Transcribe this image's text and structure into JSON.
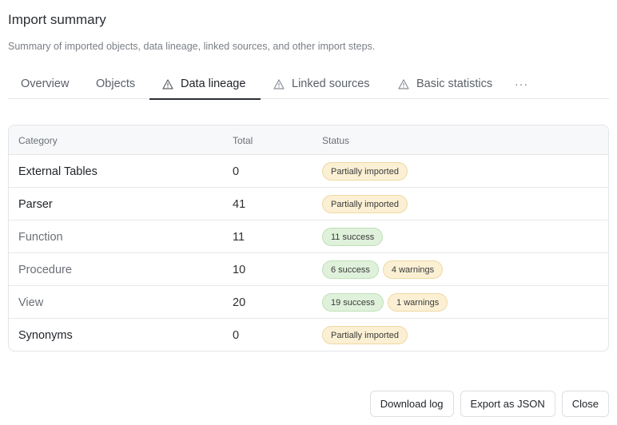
{
  "header": {
    "title": "Import summary",
    "subtitle": "Summary of imported objects, data lineage, linked sources, and other import steps."
  },
  "tabs": [
    {
      "label": "Overview",
      "warning": false,
      "active": false
    },
    {
      "label": "Objects",
      "warning": false,
      "active": false
    },
    {
      "label": "Data lineage",
      "warning": true,
      "active": true
    },
    {
      "label": "Linked sources",
      "warning": true,
      "active": false
    },
    {
      "label": "Basic statistics",
      "warning": true,
      "active": false
    }
  ],
  "more_label": "···",
  "table": {
    "columns": [
      "Category",
      "Total",
      "Status"
    ],
    "rows": [
      {
        "category": "External Tables",
        "total": "0",
        "statuses": [
          "Partially imported"
        ]
      },
      {
        "category": "Parser",
        "total": "41",
        "statuses": [
          "Partially imported"
        ]
      },
      {
        "category": "Function",
        "total": "11",
        "statuses": [
          "11 success"
        ]
      },
      {
        "category": "Procedure",
        "total": "10",
        "statuses": [
          "6 success",
          "4 warnings"
        ]
      },
      {
        "category": "View",
        "total": "20",
        "statuses": [
          "19 success",
          "1 warnings"
        ]
      },
      {
        "category": "Synonyms",
        "total": "0",
        "statuses": [
          "Partially imported"
        ]
      }
    ]
  },
  "footer": {
    "download_label": "Download log",
    "export_label": "Export as JSON",
    "close_label": "Close"
  },
  "colors": {
    "warning_badge_bg": "#fbf0d4",
    "success_badge_bg": "#dff1db",
    "active_tab_underline": "#2b2f33"
  },
  "icons": {
    "tab_warning": "warning-triangle-icon",
    "more": "more-horizontal-icon"
  }
}
